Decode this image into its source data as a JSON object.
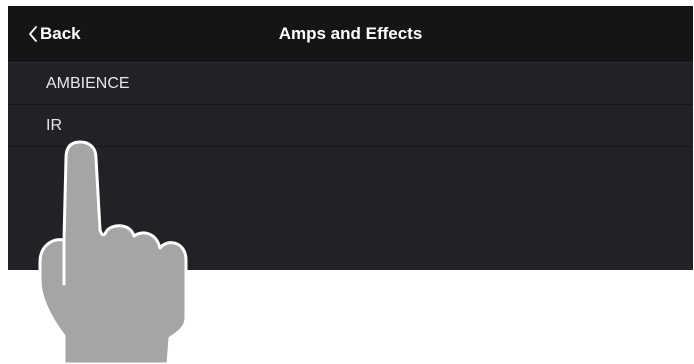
{
  "header": {
    "back_label": "Back",
    "title": "Amps and Effects"
  },
  "list": {
    "items": [
      {
        "label": "AMBIENCE"
      },
      {
        "label": "IR"
      }
    ]
  },
  "overlay": {
    "icon": "pointing-hand-icon"
  },
  "colors": {
    "nav_background": "#141516",
    "screen_background": "#202226",
    "text": "#ffffff",
    "hand_fill": "#a4a6a6"
  }
}
